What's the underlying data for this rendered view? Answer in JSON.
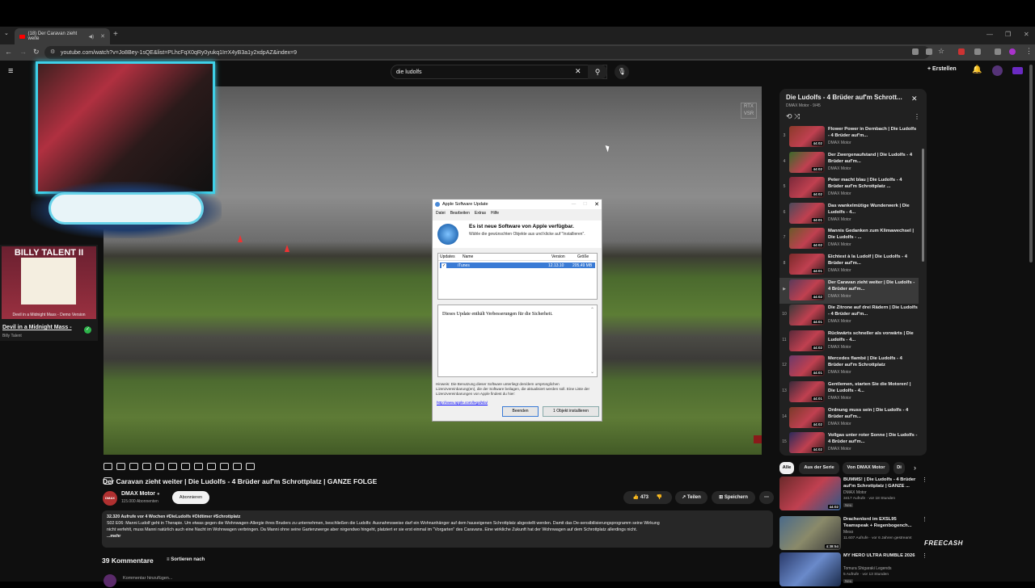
{
  "browser": {
    "tab_title": "(18) Der Caravan zieht weite",
    "url": "youtube.com/watch?v=Jo8Bey-1sQE&list=PLhcFqX0qRy0yukq1IrrX4yB3a1y2xdpAZ&index=9"
  },
  "youtube": {
    "search_value": "die ludolfs",
    "create_label": "Erstellen"
  },
  "overlay": {
    "rtx_label_1": "RTX",
    "rtx_label_2": "VSR",
    "album_title": "BILLY TALENT II",
    "album_sub": "Devil in a Midnight Mass - Demo Version",
    "song_title": "Devil in a Midnight Mass -",
    "song_artist": "Billy Talent"
  },
  "dialog": {
    "window_title": "Apple Software Update",
    "menu": [
      "Datei",
      "Bearbeiten",
      "Extras",
      "Hilfe"
    ],
    "heading": "Es ist neue Software von Apple verfügbar.",
    "subheading": "Wähle die gewünschten Objekte aus und klicke auf \"Installieren\".",
    "col_updates": "Updates",
    "col_name": "Name",
    "col_version": "Version",
    "col_size": "Größe",
    "row_name": "iTunes",
    "row_version": "12.13.10",
    "row_size": "205,49 MB",
    "description": "Dieses Update enthält Verbesserungen für die Sicherheit.",
    "note": "Hinweis: Die Benutzung dieser Software unterliegt den/dem ursprünglichen Lizenzvereinbarung(en), die der Software beilagen, die aktualisiert werden soll. Eine Liste der Lizenzvereinbarungen von Apple findest du hier:",
    "link": "http://www.apple.com/legal/sla/",
    "quit_button": "Beenden",
    "install_button": "1 Objekt installieren"
  },
  "video": {
    "title": "Der Caravan zieht weiter | Die Ludolfs - 4 Brüder auf'm Schrottplatz | GANZE FOLGE",
    "channel": "DMAX Motor",
    "subscribers": "115.000 Abonnenten",
    "subscribe_label": "Abonnieren",
    "likes": "473",
    "share_label": "Teilen",
    "save_label": "Speichern",
    "desc_line1": "32.320 Aufrufe  vor 4 Wochen  #DieLudolfs #Oldtimer #Schrottplatz",
    "desc_line2": "S02 E06: Manni Ludolf geht in Therapie. Um etwas gegen die Wohnwagen-Allergie ihres Bruders zu unternehmen, beschließen die Ludolfs: Ausnahmsweise darf ein Wohnanhänger auf dem hauseigenen Schrottplatz abgestellt werden. Damit das De-sensibilisierungsprogramm seine Wirkung",
    "desc_line3": "nicht verfehlt, muss Manni natürlich auch eine Nacht im Wohnwagen verbringen. Da Manni ohne seine Gartenzwerge aber nirgendwo hingeht, platziert er sie erst einmal im \"Vorgarten\" des Caravans. Eine wirkliche Zukunft hat der Wohnwagen auf dem Schrottplatz allerdings nicht.",
    "desc_more": "...mehr",
    "comments_count": "39 Kommentare",
    "sort_label": "Sortieren nach",
    "comment_placeholder": "Kommentar hinzufügen..."
  },
  "playlist": {
    "title": "Die Ludolfs - 4 Brüder auf'm Schrott...",
    "subtitle": "DMAX Motor - 9/45",
    "items": [
      {
        "num": "3",
        "title": "Flower Power in Dernbach | Die Ludolfs - 4 Brüder auf'm...",
        "channel": "DMAX Motor",
        "duration": "44:02"
      },
      {
        "num": "4",
        "title": "Der Zwergenaufstand | Die Ludolfs - 4 Brüder auf'm...",
        "channel": "DMAX Motor",
        "duration": "44:02"
      },
      {
        "num": "5",
        "title": "Peter macht blau | Die Ludolfs - 4 Brüder auf'm Schrottplatz ...",
        "channel": "DMAX Motor",
        "duration": "44:02"
      },
      {
        "num": "6",
        "title": "Das wankelmütige Wunderwerk | Die Ludolfs - 4...",
        "channel": "DMAX Motor",
        "duration": "44:01"
      },
      {
        "num": "7",
        "title": "Mannis Gedanken zum Klimawechsel | Die Ludolfs - ...",
        "channel": "DMAX Motor",
        "duration": "44:02"
      },
      {
        "num": "8",
        "title": "Eichtest à la Ludolf | Die Ludolfs - 4 Brüder auf'm...",
        "channel": "DMAX Motor",
        "duration": "44:01"
      },
      {
        "num": "▶",
        "title": "Der Caravan zieht weiter | Die Ludolfs - 4 Brüder auf'm...",
        "channel": "DMAX Motor",
        "duration": "44:02"
      },
      {
        "num": "10",
        "title": "Die Zitrone auf drei Rädern | Die Ludolfs - 4 Brüder auf'm...",
        "channel": "DMAX Motor",
        "duration": "44:01"
      },
      {
        "num": "11",
        "title": "Rückwärts schneller als vorwärts | Die Ludolfs - 4...",
        "channel": "DMAX Motor",
        "duration": "44:02"
      },
      {
        "num": "12",
        "title": "Mercedes flambé | Die Ludolfs - 4 Brüder auf'm Schrottplatz",
        "channel": "DMAX Motor",
        "duration": "44:01"
      },
      {
        "num": "13",
        "title": "Gentlemen, starten Sie die Motoren! | Die Ludolfs - 4...",
        "channel": "DMAX Motor",
        "duration": "44:01"
      },
      {
        "num": "14",
        "title": "Ordnung muss sein | Die Ludolfs - 4 Brüder auf'm...",
        "channel": "DMAX Motor",
        "duration": "44:02"
      },
      {
        "num": "15",
        "title": "Vollgas unter roter Sonne | Die Ludolfs - 4 Brüder auf'm...",
        "channel": "DMAX Motor",
        "duration": "44:02"
      }
    ]
  },
  "chips": [
    "Alle",
    "Aus der Serie",
    "Von DMAX Motor",
    "Di"
  ],
  "recommendations": [
    {
      "title": "BUMMS! | Die Ludolfs - 4 Brüder auf'm Schrottplatz | GANZE ...",
      "channel": "DMAX Motor",
      "meta": "3417 Aufrufe · vor 18 Stunden",
      "badge": "Neu",
      "duration": "44:02"
    },
    {
      "title": "Drachenlord im EXSL95 Teamspeak + Regenbogench...",
      "channel": "Meso",
      "meta": "11.607 Aufrufe · vor 6 Jahren gestreamt",
      "badge": "",
      "duration": "4:38:54"
    },
    {
      "title": "MY HERO ULTRA RUMBLE 2026",
      "channel": "Tomura Shigaraki Legends",
      "meta": "5 Aufrufe · vor 13 Stunden",
      "badge": "Neu",
      "duration": ""
    }
  ],
  "freecash": "FREECASH"
}
